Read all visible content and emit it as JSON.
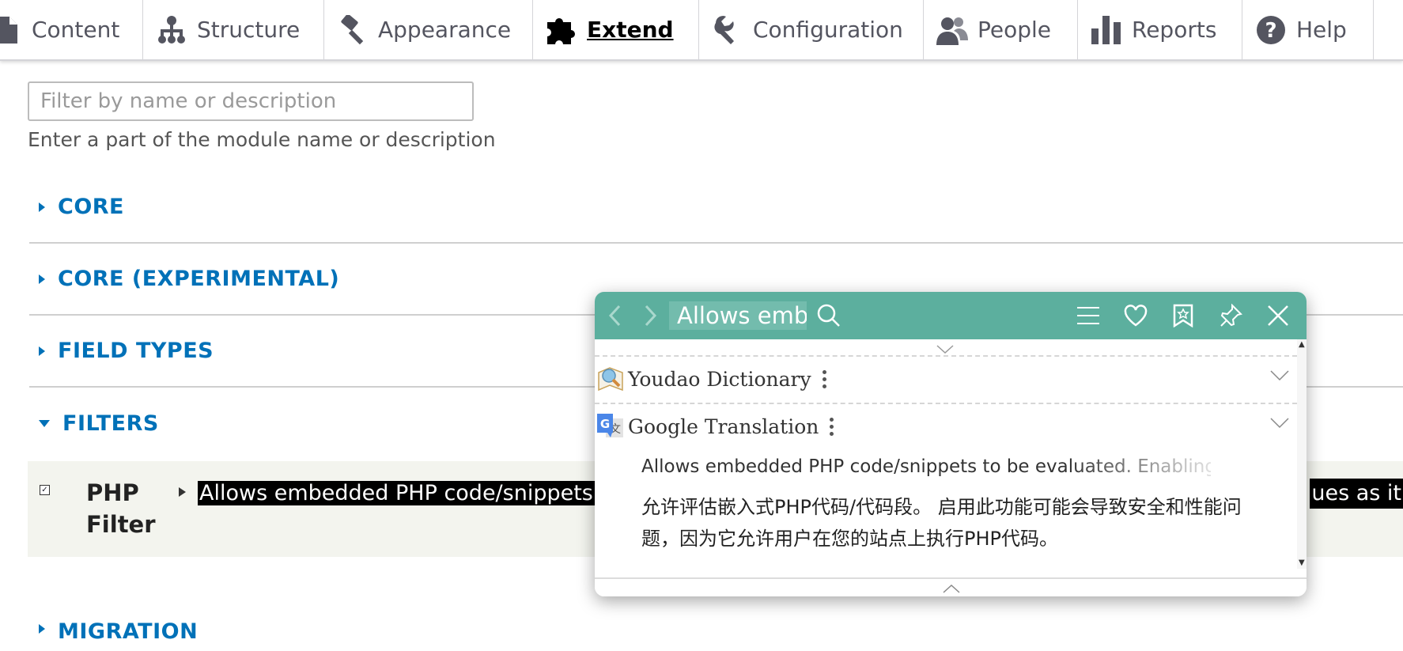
{
  "toolbar": {
    "tabs": [
      {
        "label": "Content",
        "icon": "document-icon"
      },
      {
        "label": "Structure",
        "icon": "sitemap-icon"
      },
      {
        "label": "Appearance",
        "icon": "paint-icon"
      },
      {
        "label": "Extend",
        "icon": "puzzle-icon",
        "active": true
      },
      {
        "label": "Configuration",
        "icon": "wrench-icon"
      },
      {
        "label": "People",
        "icon": "person-icon"
      },
      {
        "label": "Reports",
        "icon": "bar-chart-icon"
      },
      {
        "label": "Help",
        "icon": "help-icon"
      }
    ]
  },
  "filter": {
    "placeholder": "Filter by name or description",
    "value": "",
    "help": "Enter a part of the module name or description"
  },
  "sections": [
    {
      "label": "CORE",
      "expanded": false
    },
    {
      "label": "CORE (EXPERIMENTAL)",
      "expanded": false
    },
    {
      "label": "FIELD TYPES",
      "expanded": false
    },
    {
      "label": "FILTERS",
      "expanded": true
    },
    {
      "label": "MIGRATION",
      "expanded": false
    }
  ],
  "module": {
    "name": "PHP Filter",
    "checked": true,
    "description_left": "Allows embedded PHP code/snippets to",
    "description_right": "ues as it"
  },
  "popup": {
    "search_value": "Allows emb",
    "dictionaries": [
      {
        "name": "Youdao Dictionary",
        "icon": "youdao-icon"
      },
      {
        "name": "Google Translation",
        "icon": "google-translate-icon"
      }
    ],
    "source_text": "Allows embedded PHP code/snippets to be evaluated. Enabling",
    "translation": "允许评估嵌入式PHP代码/代码段。 启用此功能可能会导致安全和性能问题，因为它允许用户在您的站点上执行PHP代码。"
  },
  "colors": {
    "accent": "#0071b8",
    "popup_header": "#5caf9e",
    "module_row_bg": "#f3f4ee"
  }
}
